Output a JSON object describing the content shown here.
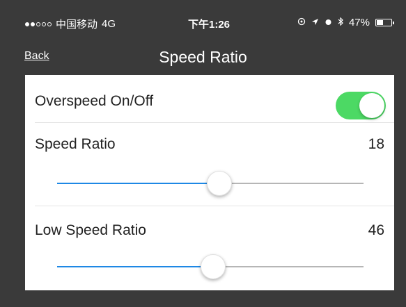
{
  "status_bar": {
    "carrier": "中国移动",
    "network": "4G",
    "time": "下午1:26",
    "battery_percent": "47%",
    "battery_level": 0.47,
    "signal_bars_filled": 2,
    "icons": [
      "location-icon",
      "arrow-icon",
      "alarm-icon",
      "bluetooth-icon"
    ]
  },
  "nav": {
    "back_label": "Back",
    "title": "Speed Ratio"
  },
  "settings": {
    "overspeed": {
      "label": "Overspeed On/Off",
      "enabled": true
    },
    "speed_ratio": {
      "label": "Speed Ratio",
      "value": "18",
      "slider_fraction": 0.53
    },
    "low_speed_ratio": {
      "label": "Low Speed Ratio",
      "value": "46",
      "slider_fraction": 0.51
    }
  },
  "colors": {
    "toggle_on": "#4cd964",
    "slider_fill": "#1e88e5",
    "background": "#3a3a3a"
  }
}
